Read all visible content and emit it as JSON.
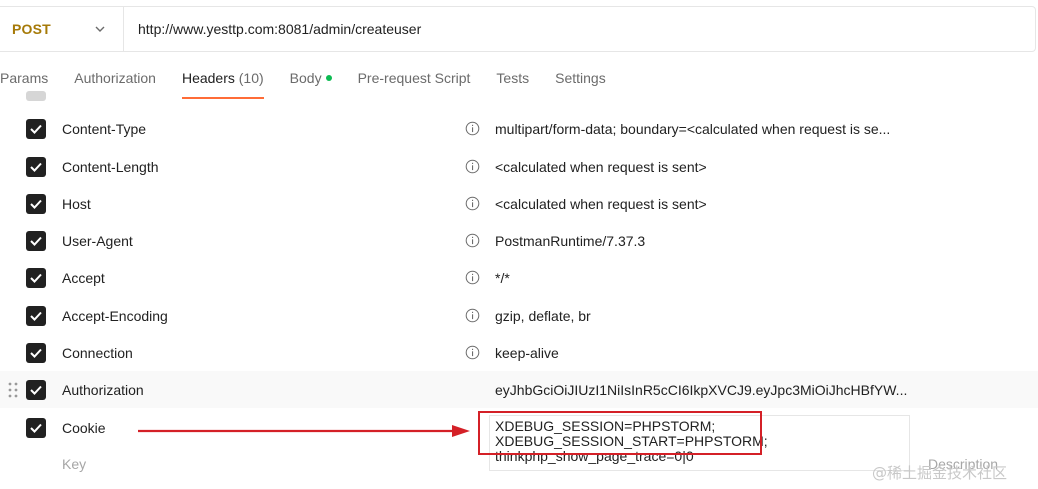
{
  "request": {
    "method": "POST",
    "url": "http://www.yesttp.com:8081/admin/createuser"
  },
  "tabs": [
    {
      "label": "Params"
    },
    {
      "label": "Authorization"
    },
    {
      "label": "Headers",
      "count": "(10)",
      "active": true
    },
    {
      "label": "Body",
      "has_dot": true
    },
    {
      "label": "Pre-request Script"
    },
    {
      "label": "Tests"
    },
    {
      "label": "Settings"
    }
  ],
  "headers": [
    {
      "key": "Content-Type",
      "value": "multipart/form-data; boundary=<calculated when request is se...",
      "checked": true,
      "info": true
    },
    {
      "key": "Content-Length",
      "value": "<calculated when request is sent>",
      "checked": true,
      "info": true
    },
    {
      "key": "Host",
      "value": "<calculated when request is sent>",
      "checked": true,
      "info": true
    },
    {
      "key": "User-Agent",
      "value": "PostmanRuntime/7.37.3",
      "checked": true,
      "info": true
    },
    {
      "key": "Accept",
      "value": "*/*",
      "checked": true,
      "info": true
    },
    {
      "key": "Accept-Encoding",
      "value": "gzip, deflate, br",
      "checked": true,
      "info": true
    },
    {
      "key": "Connection",
      "value": "keep-alive",
      "checked": true,
      "info": true
    },
    {
      "key": "Authorization",
      "value": "eyJhbGciOiJIUzI1NiIsInR5cCI6IkpXVCJ9.eyJpc3MiOiJhcHBfYW...",
      "checked": true,
      "info": false
    },
    {
      "key": "Cookie",
      "value": "XDEBUG_SESSION=PHPSTORM;\nXDEBUG_SESSION_START=PHPSTORM;\nthinkphp_show_page_trace=0|0",
      "checked": true,
      "info": false
    }
  ],
  "new_row": {
    "key_placeholder": "Key",
    "description_placeholder": "Description"
  },
  "watermark": "@稀土掘金技术社区",
  "colors": {
    "method": "#a67a08",
    "active_tab_underline": "#ff6c37",
    "body_dot": "#0cbb52",
    "annotation": "#d42027"
  },
  "icons": {
    "method_dropdown": "chevron-down-icon",
    "header_info": "info-icon",
    "row_drag": "drag-handle-icon",
    "checkbox": "checkmark-icon"
  }
}
